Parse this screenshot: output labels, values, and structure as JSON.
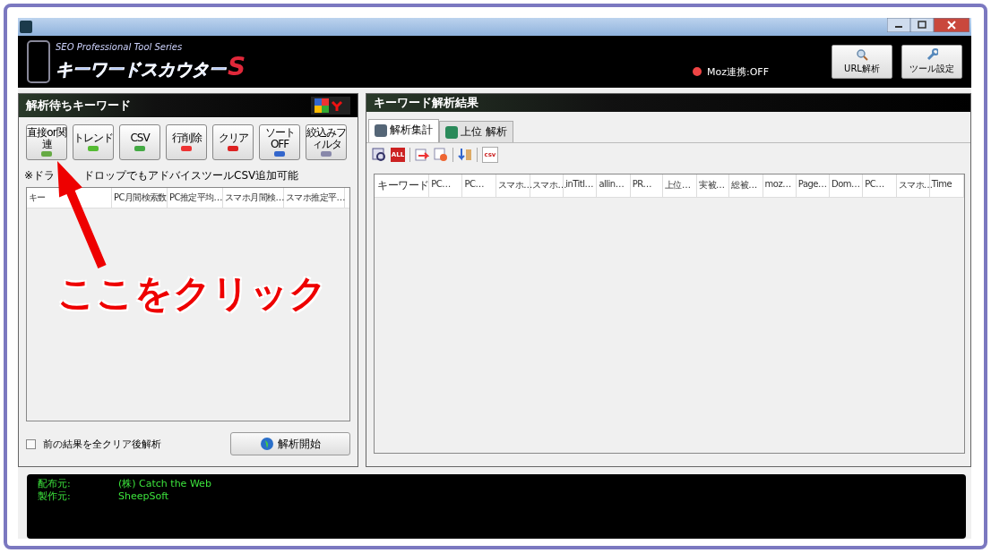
{
  "header": {
    "logo_subtitle": "SEO Professional Tool Series",
    "logo_title": "キーワードスカウター",
    "logo_mark": "S",
    "moz_status": "Moz連携:OFF",
    "moz_on": false,
    "buttons": [
      {
        "label": "URL解析",
        "kind": "search"
      },
      {
        "label": "ツール設定",
        "kind": "wrench"
      }
    ]
  },
  "left_panel": {
    "title": "解析待ちキーワード",
    "tools": [
      {
        "label": "直接or関連",
        "kind": "leaf"
      },
      {
        "label": "トレンド",
        "kind": "trend"
      },
      {
        "label": "CSV",
        "kind": "csv"
      },
      {
        "label": "行削除",
        "kind": "delete"
      },
      {
        "label": "クリア",
        "kind": "clear"
      },
      {
        "label": "ソートOFF",
        "kind": "sort"
      },
      {
        "label": "絞込みフィルタ",
        "kind": "filter"
      }
    ],
    "note_parts": [
      "※ドラ",
      "ドロップでもアドバイスツールCSV追加可能"
    ],
    "columns": [
      "キー",
      "PC月間検索数",
      "PC推定平均…",
      "スマホ月間検…",
      "スマホ推定平…"
    ],
    "clear_option": {
      "label": "前の結果を全クリア後解析",
      "checked": false
    },
    "start_button": "解析開始"
  },
  "right_panel": {
    "title": "キーワード解析結果",
    "tabs": [
      {
        "label": "解析集計",
        "selected": true
      },
      {
        "label": "上位 解析",
        "selected": false
      }
    ],
    "toolbar": [
      {
        "kind": "zoom"
      },
      {
        "kind": "all",
        "label": "ALL"
      },
      {
        "kind": "sep"
      },
      {
        "kind": "export"
      },
      {
        "kind": "remove"
      },
      {
        "kind": "sep"
      },
      {
        "kind": "sort"
      },
      {
        "kind": "sep"
      },
      {
        "kind": "csv",
        "label": "csv"
      }
    ],
    "columns": [
      "キーワード",
      "PC…",
      "PC…",
      "スマホ…",
      "スマホ…",
      "inTitl…",
      "allin…",
      "PR…",
      "上位…",
      "実被…",
      "総被…",
      "moz…",
      "Page…",
      "Dom…",
      "PC…",
      "スマホ…",
      "Time"
    ]
  },
  "console": [
    {
      "label": "配布元:",
      "value": "(株) Catch the Web"
    },
    {
      "label": "製作元:",
      "value": "SheepSoft"
    }
  ],
  "annotation": {
    "text": "ここをクリック"
  }
}
